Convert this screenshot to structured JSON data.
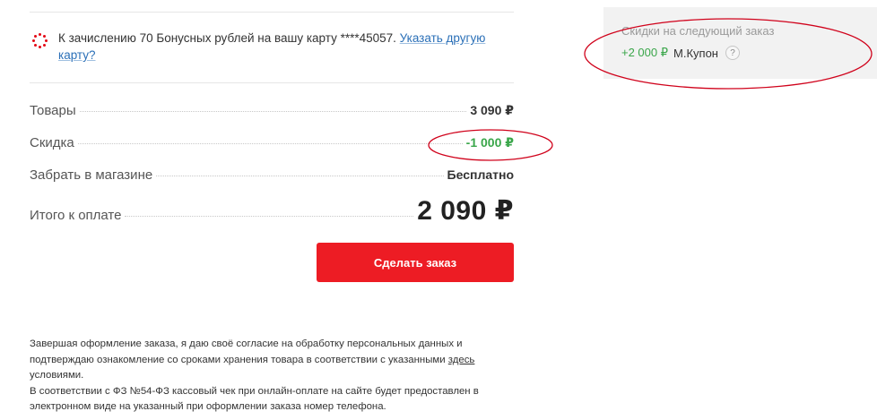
{
  "bonus": {
    "text": "К зачислению 70 Бонусных рублей на вашу карту ****45057. ",
    "link": "Указать другую карту?"
  },
  "summary": {
    "rows": [
      {
        "label": "Товары",
        "value": "3 090 ₽"
      },
      {
        "label": "Скидка",
        "value": "-1 000 ₽"
      },
      {
        "label": "Забрать в магазине",
        "value": "Бесплатно"
      }
    ],
    "total": {
      "label": "Итого к оплате",
      "value": "2 090 ₽"
    }
  },
  "actions": {
    "order_button": "Сделать заказ"
  },
  "footnote": {
    "part1": "Завершая оформление заказа, я даю своё согласие на обработку персональных данных и подтверждаю ознакомление со сроками хранения товара в соответствии с указанными ",
    "link": "здесь",
    "part2": " условиями.",
    "line2": "В соответствии с ФЗ №54-ФЗ кассовый чек при онлайн-оплате на сайте будет предоставлен в электронном виде на указанный при оформлении заказа номер телефона."
  },
  "next_order": {
    "title": "Скидки на следующий заказ",
    "bonus": "+2 000 ₽",
    "coupon": "М.Купон",
    "help": "?"
  },
  "colors": {
    "accent_red": "#ed1c24",
    "discount_green": "#3aa64a",
    "link_blue": "#2a6fb7",
    "annotation_red": "#d0021b"
  }
}
